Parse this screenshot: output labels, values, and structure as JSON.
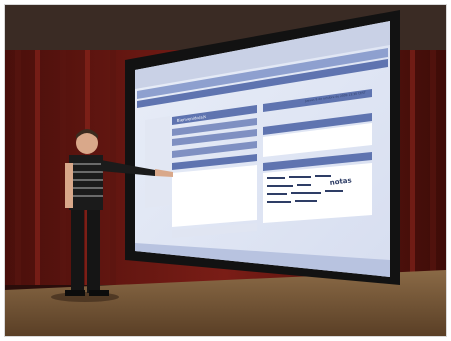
{
  "screen_ui": {
    "section_title": "Bienvenido/a/s",
    "date_line": "Jueves 8 de octubre de 2009 13:30 CEST",
    "tag_word": "notas"
  },
  "colors": {
    "curtain": "#7a1d16",
    "stage_floor": "#7a5a3a",
    "screen_bg": "#f4f6fb",
    "ui_header": "#5f74b0",
    "presenter_shirt": "#1b1b1b"
  }
}
